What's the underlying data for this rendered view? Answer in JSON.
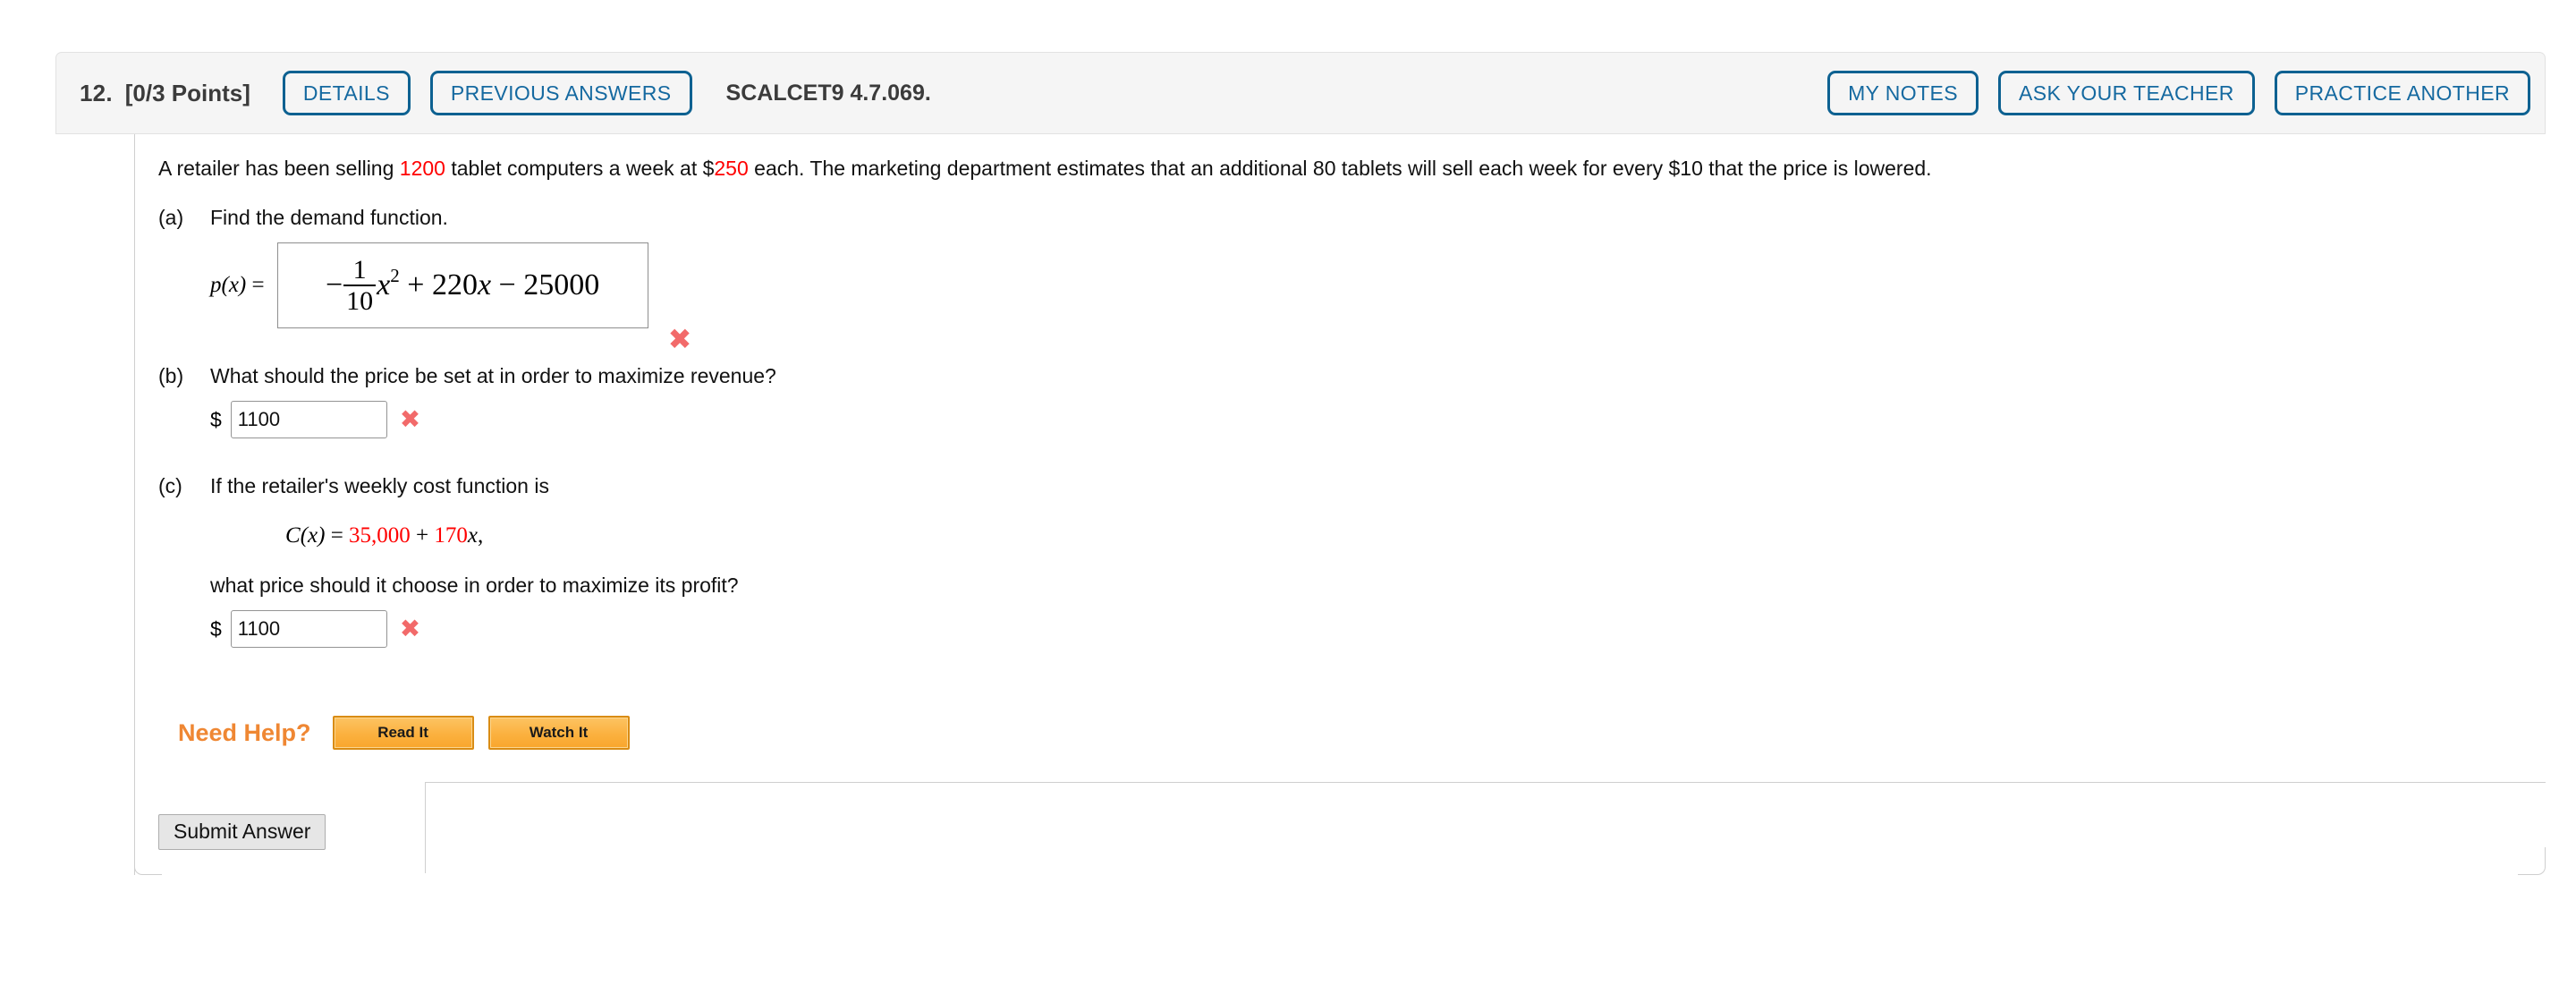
{
  "header": {
    "question_number": "12.",
    "points": "[0/3 Points]",
    "buttons_left": [
      {
        "name": "details",
        "label": "DETAILS"
      },
      {
        "name": "previous-answers",
        "label": "PREVIOUS ANSWERS"
      }
    ],
    "textbook_reference": "SCALCET9 4.7.069.",
    "buttons_right": [
      {
        "name": "my-notes",
        "label": "MY NOTES"
      },
      {
        "name": "ask-your-teacher",
        "label": "ASK YOUR TEACHER"
      },
      {
        "name": "practice-another",
        "label": "PRACTICE ANOTHER"
      }
    ]
  },
  "problem": {
    "prompt_part1": "A retailer has been selling ",
    "prompt_qty": "1200",
    "prompt_part2": " tablet computers a week at $",
    "prompt_price": "250",
    "prompt_part3": " each. The marketing department estimates that an additional 80 tablets will sell each week for every $10 that the price is lowered."
  },
  "parts": {
    "a": {
      "tag": "(a)",
      "text": "Find the demand function.",
      "answer_label_fn": "p(x)",
      "answer_label_eq": "=",
      "answer": {
        "sign": "−",
        "frac_num": "1",
        "frac_den": "10",
        "var": "x",
        "exponent": "2",
        "plus": "+",
        "coefficient": "220",
        "var2": "x",
        "minus": "−",
        "constant": "25000"
      },
      "status_icon": "incorrect-x-icon",
      "status_glyph": "✖"
    },
    "b": {
      "tag": "(b)",
      "text": "What should the price be set at in order to maximize revenue?",
      "currency": "$",
      "value": "1100",
      "placeholder": "",
      "status_icon": "incorrect-x-icon",
      "status_glyph": "✖"
    },
    "c": {
      "tag": "(c)",
      "text": "If the retailer's weekly cost function is",
      "cost_fn_name": "C",
      "cost_fn_var": "(x)",
      "cost_eq": "=",
      "cost_constant": "35,000",
      "cost_plus": "+",
      "cost_rate": "170",
      "cost_rate_var": "x",
      "cost_comma": ",",
      "question": "what price should it choose in order to maximize its profit?",
      "currency": "$",
      "value": "1100",
      "placeholder": "",
      "status_icon": "incorrect-x-icon",
      "status_glyph": "✖"
    }
  },
  "need_help": {
    "label": "Need Help?",
    "buttons": [
      {
        "name": "read-it",
        "label": "Read It"
      },
      {
        "name": "watch-it",
        "label": "Watch It"
      }
    ]
  },
  "footer": {
    "submit_label": "Submit Answer"
  },
  "colors": {
    "accent_blue": "#0d6191",
    "link_blue": "#1569a0",
    "red_value": "#ff0000",
    "incorrect_x": "#f26a6a",
    "help_orange": "#ef8733",
    "help_button": "#fbb13f",
    "header_bg": "#f5f5f5"
  }
}
